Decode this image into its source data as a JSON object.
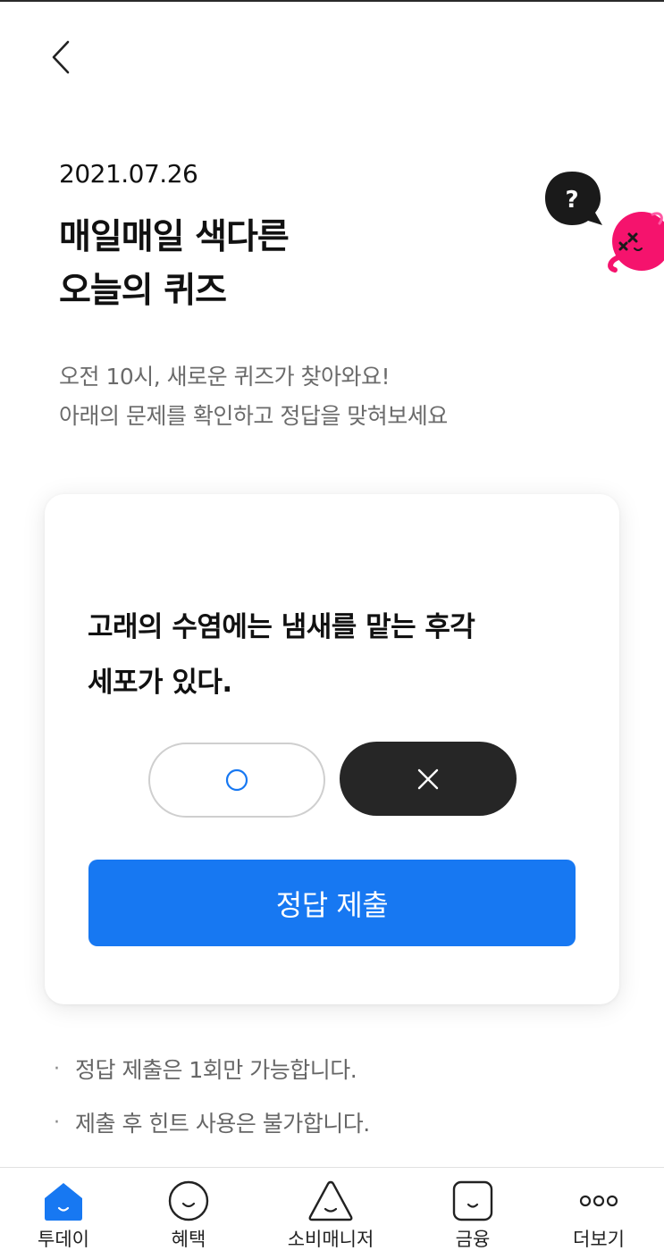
{
  "header": {
    "date": "2021.07.26",
    "title_lines": [
      "매일매일 색다른",
      "오늘의 퀴즈"
    ],
    "subtitle_lines": [
      "오전 10시, 새로운 퀴즈가 찾아와요!",
      "아래의 문제를 확인하고 정답을 맞혀보세요"
    ]
  },
  "quiz": {
    "question_lines": [
      "고래의 수염에는 냄새를 맡는 후각",
      "세포가 있다."
    ],
    "options": [
      "O",
      "X"
    ],
    "selected": "X",
    "submit_label": "정답 제출"
  },
  "notes": [
    "정답 제출은 1회만 가능합니다.",
    "제출 후 힌트 사용은 불가합니다."
  ],
  "bottom_nav": {
    "active": "투데이",
    "items": [
      {
        "label": "투데이",
        "icon": "home-icon"
      },
      {
        "label": "혜택",
        "icon": "smile-circle-icon"
      },
      {
        "label": "소비매니저",
        "icon": "triangle-face-icon"
      },
      {
        "label": "금융",
        "icon": "square-face-icon"
      },
      {
        "label": "더보기",
        "icon": "more-dots-icon"
      }
    ]
  },
  "colors": {
    "accent": "#1778f2",
    "mascot": "#f5136d",
    "selected_option": "#262626",
    "o_mark": "#1778f2"
  }
}
